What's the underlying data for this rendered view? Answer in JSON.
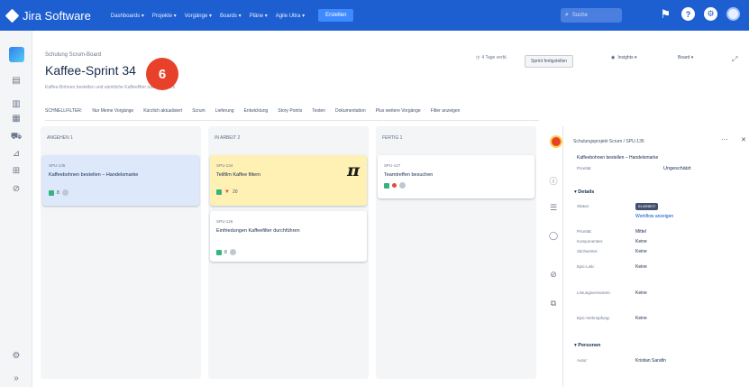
{
  "topnav": {
    "app_name": "Jira Software",
    "menu": [
      "Dashboards ▾",
      "Projekte ▾",
      "Vorgänge ▾",
      "Boards ▾",
      "Pläne ▾",
      "Agile Ultra ▾"
    ],
    "create_label": "Erstellen",
    "search_placeholder": "Suche"
  },
  "header": {
    "breadcrumb": "Schulung Scrum-Board",
    "title": "Kaffee-Sprint 34",
    "subtitle": "Kaffee-Bohnen bestellen und sämtliche Kaffeefilter nachbestellen",
    "step_number": "6",
    "days_left": "4 Tage verbl.",
    "complete_sprint": "Sprint fertigstellen",
    "insights": "Insights ▾",
    "board_menu": "Board ▾"
  },
  "filters": [
    "SCHNELLFILTER:",
    "Nur Meine Vorgänge",
    "Kürzlich aktualisiert",
    "Scrum",
    "Lieferung",
    "Entwicklung",
    "Story Points",
    "Testen",
    "Dokumentation",
    "Plus weitere Vorgänge",
    "Filter anzeigen"
  ],
  "columns": [
    {
      "name": "ANGEHEN 1",
      "cards": [
        {
          "key": "SPU-135",
          "title": "Kaffeebohnen bestellen – Handelsmarke",
          "estimate": "8"
        }
      ]
    },
    {
      "name": "IN ARBEIT 2",
      "cards": [
        {
          "key": "SPU-134",
          "title": "Teilfilm Kaffee filtern",
          "estimate": "20"
        },
        {
          "key": "SPU-126",
          "title": "Einfriedungen Kaffeefilter durchführen",
          "estimate": "8"
        }
      ]
    },
    {
      "name": "FERTIG 1",
      "cards": [
        {
          "key": "SPU-127",
          "title": "Teamtreffen besuchen",
          "estimate": ""
        }
      ]
    }
  ],
  "detail": {
    "breadcrumb": "Schulungsprojekt Scrum / SPU-135",
    "title": "Kaffeebohnen bestellen – Handelsmarke",
    "priority_label": "Priorität",
    "priority_value": "Ungeschätzt",
    "details_heading": "Details",
    "status_label": "Status:",
    "status_value": "IN ARBEIT",
    "workflow_link": "Workflow anzeigen",
    "fields": [
      {
        "label": "Priorität:",
        "value": "Mittel"
      },
      {
        "label": "Komponenten:",
        "value": "Keine"
      },
      {
        "label": "Stichwörter:",
        "value": "Keine"
      },
      {
        "label": "Epic-Link:",
        "value": "Keine"
      },
      {
        "label": "Lösungsversionen:",
        "value": "Keine"
      },
      {
        "label": "Epic-Verknüpfung:",
        "value": "Keine"
      }
    ],
    "people_heading": "Personen",
    "assignee_label": "Autor:",
    "assignee_value": "Kristian Sarafin"
  }
}
